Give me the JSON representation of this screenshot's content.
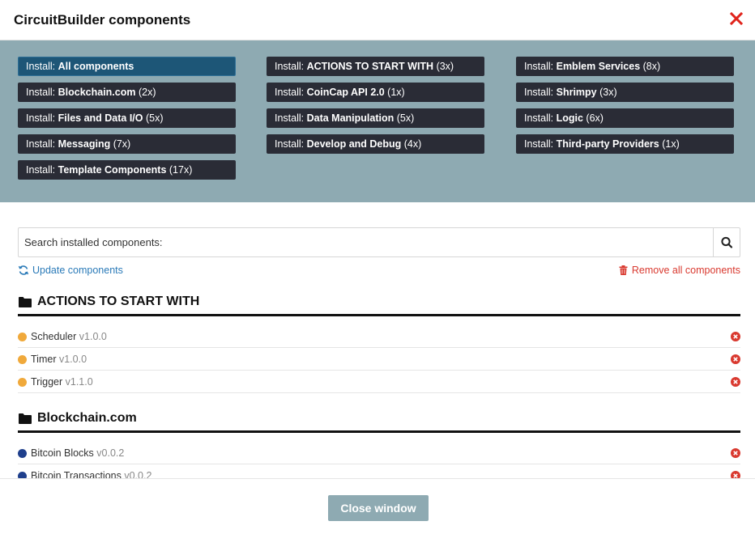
{
  "header": {
    "title": "CircuitBuilder components"
  },
  "install": {
    "prefix": "Install: ",
    "buttons": [
      {
        "name": "All components",
        "count": ""
      },
      {
        "name": "ACTIONS TO START WITH",
        "count": " (3x)"
      },
      {
        "name": "Emblem Services",
        "count": " (8x)"
      },
      {
        "name": "Blockchain.com",
        "count": " (2x)"
      },
      {
        "name": "CoinCap API 2.0",
        "count": " (1x)"
      },
      {
        "name": "Shrimpy",
        "count": " (3x)"
      },
      {
        "name": "Files and Data I/O",
        "count": " (5x)"
      },
      {
        "name": "Data Manipulation",
        "count": " (5x)"
      },
      {
        "name": "Logic",
        "count": " (6x)"
      },
      {
        "name": "Messaging",
        "count": " (7x)"
      },
      {
        "name": "Develop and Debug",
        "count": " (4x)"
      },
      {
        "name": "Third-party Providers",
        "count": " (1x)"
      },
      {
        "name": "Template Components",
        "count": " (17x)"
      }
    ]
  },
  "search": {
    "placeholder": "Search installed components:"
  },
  "links": {
    "update": "Update components",
    "remove": "Remove all components"
  },
  "sections": [
    {
      "title": "ACTIONS TO START WITH",
      "items": [
        {
          "name": "Scheduler",
          "version": "v1.0.0",
          "color": "#f0a93b"
        },
        {
          "name": "Timer",
          "version": "v1.0.0",
          "color": "#f0a93b"
        },
        {
          "name": "Trigger",
          "version": "v1.1.0",
          "color": "#f0a93b"
        }
      ]
    },
    {
      "title": "Blockchain.com",
      "items": [
        {
          "name": "Bitcoin Blocks",
          "version": "v0.0.2",
          "color": "#1f3f8c"
        },
        {
          "name": "Bitcoin Transactions",
          "version": "v0.0.2",
          "color": "#1f3f8c"
        }
      ]
    }
  ],
  "footer": {
    "close_label": "Close window"
  },
  "colors": {
    "panel": "#8eaab2",
    "button": "#2a2c36",
    "active_button": "#1d5677",
    "danger": "#d9392f",
    "link": "#2a7ab8"
  }
}
